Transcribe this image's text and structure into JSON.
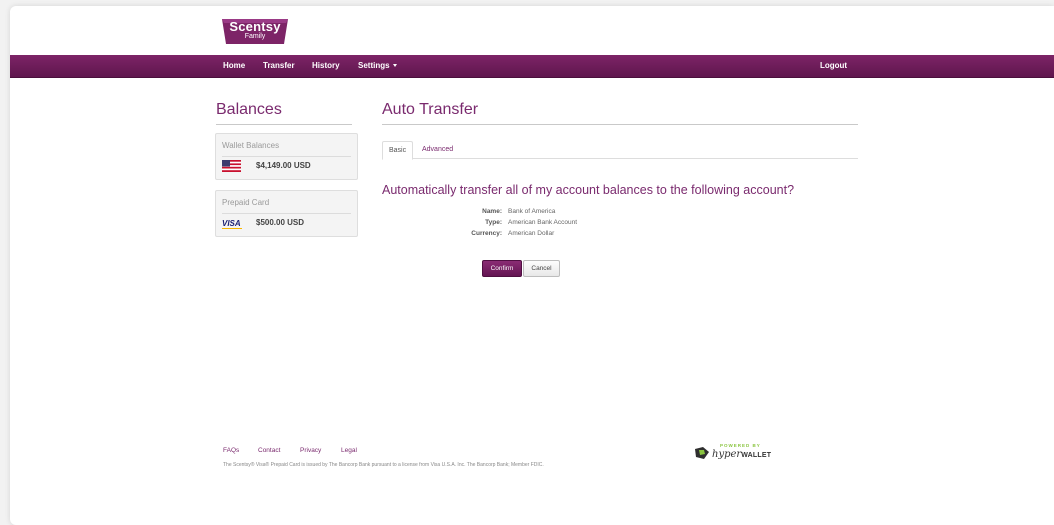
{
  "brand": {
    "name": "Scentsy",
    "sub": "Family",
    "color": "#7d2467"
  },
  "nav": {
    "home": "Home",
    "transfer": "Transfer",
    "history": "History",
    "settings": "Settings",
    "logout": "Logout"
  },
  "sidebar": {
    "title": "Balances",
    "wallet": {
      "title": "Wallet Balances",
      "amount": "$4,149.00 USD",
      "icon": "us-flag-icon"
    },
    "prepaid": {
      "title": "Prepaid Card",
      "amount": "$500.00 USD",
      "card_brand": "VISA",
      "icon": "visa-icon"
    }
  },
  "main": {
    "title": "Auto Transfer",
    "tabs": [
      {
        "label": "Basic",
        "active": true
      },
      {
        "label": "Advanced",
        "active": false
      }
    ],
    "question": "Automatically transfer all of my account balances to the following account?",
    "details": [
      {
        "label": "Name:",
        "value": "Bank of America"
      },
      {
        "label": "Type:",
        "value": "American Bank Account"
      },
      {
        "label": "Currency:",
        "value": "American Dollar"
      }
    ],
    "confirm_label": "Confirm",
    "cancel_label": "Cancel"
  },
  "footer": {
    "links": [
      "FAQs",
      "Contact",
      "Privacy",
      "Legal"
    ],
    "disclaimer": "The Scentsy® Visa® Prepaid Card is issued by The Bancorp Bank pursuant to a license from Visa U.S.A. Inc. The Bancorp Bank; Member FDIC.",
    "powered_by": "POWERED BY",
    "powered_hyper": "hyper",
    "powered_wallet": "WALLET"
  }
}
